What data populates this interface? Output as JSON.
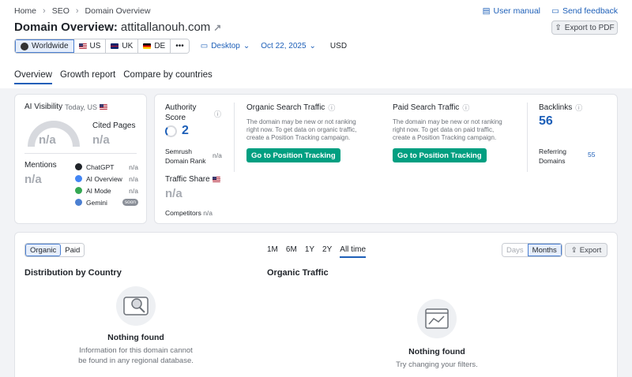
{
  "breadcrumb": [
    "Home",
    "SEO",
    "Domain Overview"
  ],
  "top_links": {
    "manual": "User manual",
    "feedback": "Send feedback"
  },
  "title": {
    "prefix": "Domain Overview:",
    "domain": "attitallanouh.com"
  },
  "export_pdf": "Export to PDF",
  "databases": [
    {
      "label": "Worldwide",
      "flag": "globe"
    },
    {
      "label": "US",
      "flag": "us"
    },
    {
      "label": "UK",
      "flag": "uk"
    },
    {
      "label": "DE",
      "flag": "de"
    },
    {
      "label": "•••",
      "flag": ""
    }
  ],
  "device": "Desktop",
  "date": "Oct 22, 2025",
  "currency": "USD",
  "tabs": [
    "Overview",
    "Growth report",
    "Compare by countries"
  ],
  "ai": {
    "title": "AI Visibility",
    "subtitle": "Today, US",
    "gauge_value": "n/a",
    "cited_label": "Cited Pages",
    "cited_value": "n/a",
    "mentions_label": "Mentions",
    "mentions_value": "n/a",
    "platforms": [
      {
        "name": "ChatGPT",
        "value": "n/a",
        "color": "#1f2329"
      },
      {
        "name": "AI Overview",
        "value": "n/a",
        "color": "#4285f4"
      },
      {
        "name": "AI Mode",
        "value": "n/a",
        "color": "#34a853"
      },
      {
        "name": "Gemini",
        "value": "soon",
        "color": "#4b7fd1"
      }
    ]
  },
  "authority": {
    "label": "Authority Score",
    "value": "2",
    "rank_label_1": "Semrush",
    "rank_label_2": "Domain Rank",
    "rank_value": "n/a",
    "share_label": "Traffic Share",
    "share_value": "n/a",
    "competitors_label": "Competitors",
    "competitors_value": "n/a"
  },
  "organic": {
    "title": "Organic Search Traffic",
    "desc_1": "The domain may be new or not ranking",
    "desc_2": "right now. To get data on organic traffic,",
    "desc_3": "create a Position Tracking campaign.",
    "button": "Go to Position Tracking"
  },
  "paid": {
    "title": "Paid Search Traffic",
    "desc_1": "The domain may be new or not ranking",
    "desc_2": "right now. To get data on paid traffic,",
    "desc_3": "create a Position Tracking campaign.",
    "button": "Go to Position Tracking"
  },
  "backlinks": {
    "label": "Backlinks",
    "value": "56",
    "ref_label_1": "Referring",
    "ref_label_2": "Domains",
    "ref_value": "55"
  },
  "bottom": {
    "toggle": [
      "Organic",
      "Paid"
    ],
    "ranges": [
      "1M",
      "6M",
      "1Y",
      "2Y",
      "All time"
    ],
    "period": [
      "Days",
      "Months"
    ],
    "export": "Export",
    "dist_title": "Distribution by Country",
    "dist_nf_title": "Nothing found",
    "dist_nf_desc_1": "Information for this domain cannot",
    "dist_nf_desc_2": "be found in any regional database.",
    "org_title": "Organic Traffic",
    "org_nf_title": "Nothing found",
    "org_nf_desc": "Try changing your filters."
  },
  "colors": {
    "accent": "#1d5fb8",
    "green": "#009f81",
    "muted": "#a7abb2"
  }
}
